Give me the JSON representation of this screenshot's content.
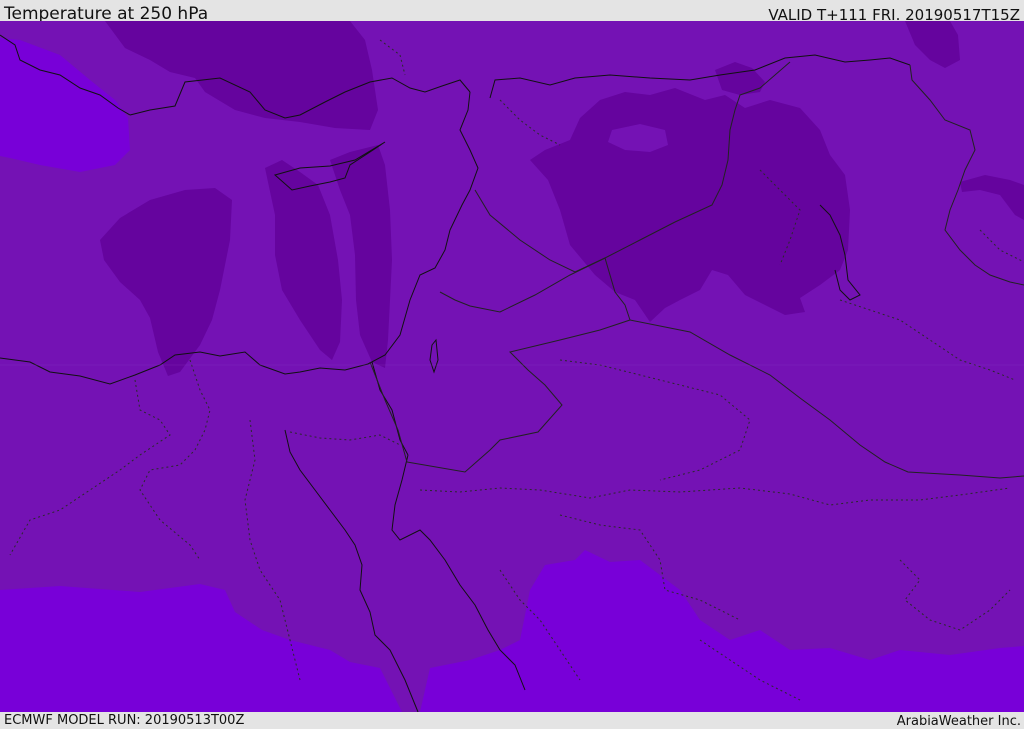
{
  "header": {
    "title": "Temperature at 250 hPa",
    "valid": "VALID T+111 FRI. 20190517T15Z"
  },
  "footer": {
    "model_run": "ECMWF MODEL RUN: 20190513T00Z",
    "credit": "ArabiaWeather Inc."
  },
  "map": {
    "colors": {
      "background": "#7412b4",
      "cold_core": "#65049e",
      "warm_fringe": "#7800d8",
      "coastline": "#111111",
      "boundary": "#222222"
    }
  }
}
